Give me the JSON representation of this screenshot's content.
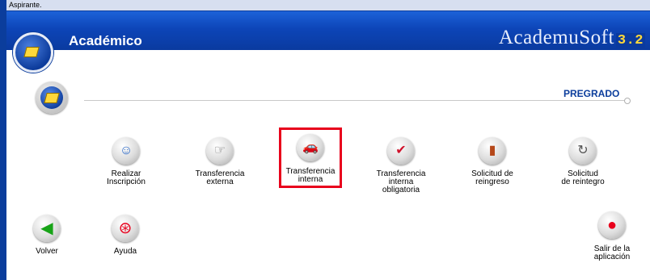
{
  "window": {
    "user_label": "Aspirante."
  },
  "header": {
    "title": "Académico",
    "brand": "AcademuSoft",
    "version": "3.2"
  },
  "section": {
    "title": "PREGRADO"
  },
  "actions": {
    "realizar_inscripcion": {
      "label": "Realizar\nInscripción",
      "icon": "form-people-icon"
    },
    "transferencia_externa": {
      "label": "Transferencia\nexterna",
      "icon": "hand-icon"
    },
    "transferencia_interna": {
      "label": "Transferencia\ninterna",
      "icon": "car-icon"
    },
    "transferencia_interna_obligatoria": {
      "label": "Transferencia\ninterna\nobligatoria",
      "icon": "car-check-icon"
    },
    "solicitud_reingreso": {
      "label": "Solicitud de\nreingreso",
      "icon": "door-icon"
    },
    "solicitud_reintegro": {
      "label": "Solicitud\nde reintegro",
      "icon": "refresh-icon"
    }
  },
  "nav": {
    "back": {
      "label": "Volver",
      "icon": "arrow-left-icon"
    },
    "help": {
      "label": "Ayuda",
      "icon": "lifebuoy-icon"
    },
    "exit": {
      "label": "Salir de la\naplicación",
      "icon": "exit-icon"
    }
  },
  "colors": {
    "header_blue": "#0d45b8",
    "accent_red": "#e8001c",
    "title_blue": "#0b3d9c"
  }
}
